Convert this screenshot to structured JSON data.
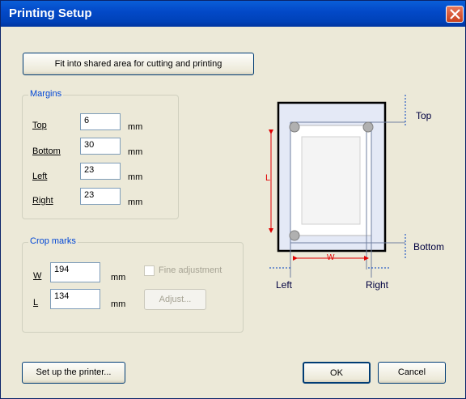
{
  "dialog": {
    "title": "Printing Setup"
  },
  "buttons": {
    "fit": "Fit into shared area for cutting and printing",
    "setup_printer": "Set up the printer...",
    "ok": "OK",
    "cancel": "Cancel",
    "adjust": "Adjust..."
  },
  "margins": {
    "legend": "Margins",
    "top": {
      "label": "Top",
      "value": "6",
      "unit": "mm"
    },
    "bottom": {
      "label": "Bottom",
      "value": "30",
      "unit": "mm"
    },
    "left": {
      "label": "Left",
      "value": "23",
      "unit": "mm"
    },
    "right": {
      "label": "Right",
      "value": "23",
      "unit": "mm"
    }
  },
  "crop_marks": {
    "legend": "Crop marks",
    "w": {
      "label": "W",
      "value": "194",
      "unit": "mm"
    },
    "l": {
      "label": "L",
      "value": "134",
      "unit": "mm"
    },
    "fine_adjustment": {
      "label": "Fine adjustment",
      "checked": false,
      "enabled": false
    }
  },
  "diagram": {
    "top": "Top",
    "bottom": "Bottom",
    "left": "Left",
    "right": "Right",
    "w": "W",
    "l": "L"
  },
  "colors": {
    "title_bar": "#0349c8",
    "group_label": "#0046d5",
    "dimension_red": "#e00000",
    "dimension_blue": "#0040c0"
  }
}
